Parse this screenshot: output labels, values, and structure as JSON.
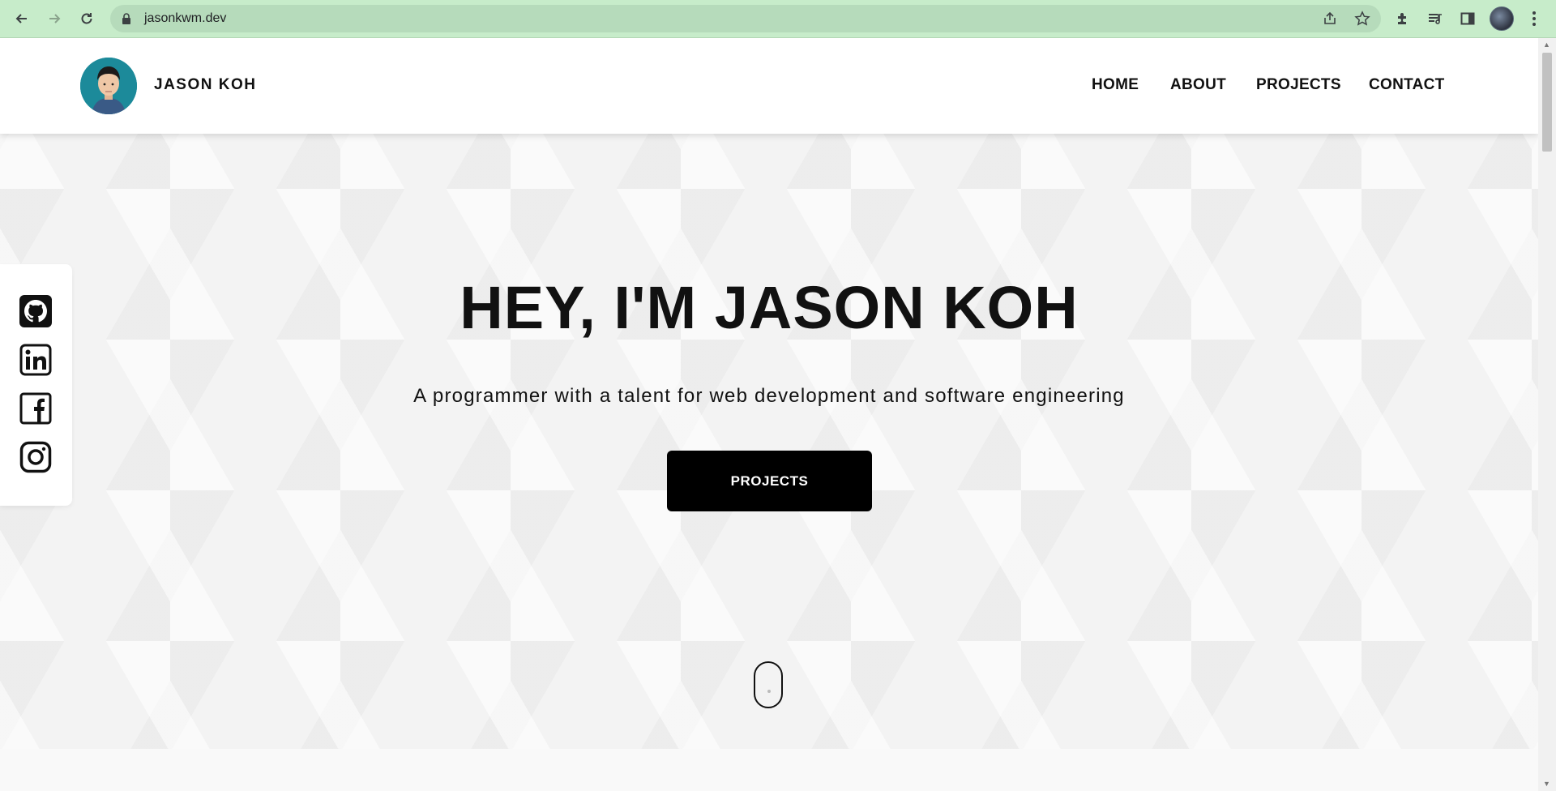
{
  "browser": {
    "url": "jasonkwm.dev",
    "icons": [
      "back-icon",
      "forward-icon",
      "reload-icon",
      "lock-icon",
      "share-icon",
      "star-icon",
      "extensions-icon",
      "media-icon",
      "side-panel-icon",
      "profile-avatar",
      "menu-icon"
    ]
  },
  "header": {
    "brand": "JASON KOH",
    "nav": [
      {
        "label": "HOME"
      },
      {
        "label": "ABOUT"
      },
      {
        "label": "PROJECTS"
      },
      {
        "label": "CONTACT"
      }
    ]
  },
  "social": {
    "icons": [
      "github-icon",
      "linkedin-icon",
      "facebook-icon",
      "instagram-icon"
    ]
  },
  "hero": {
    "headline": "HEY, I'M JASON KOH",
    "tagline": "A programmer with a talent for web development and software engineering",
    "cta_label": "PROJECTS"
  },
  "colors": {
    "chrome_bg": "#c7ecca",
    "omnibox_bg": "#b6dbbb",
    "cta_bg": "#000000",
    "hero_bg": "#f3f3f3"
  }
}
